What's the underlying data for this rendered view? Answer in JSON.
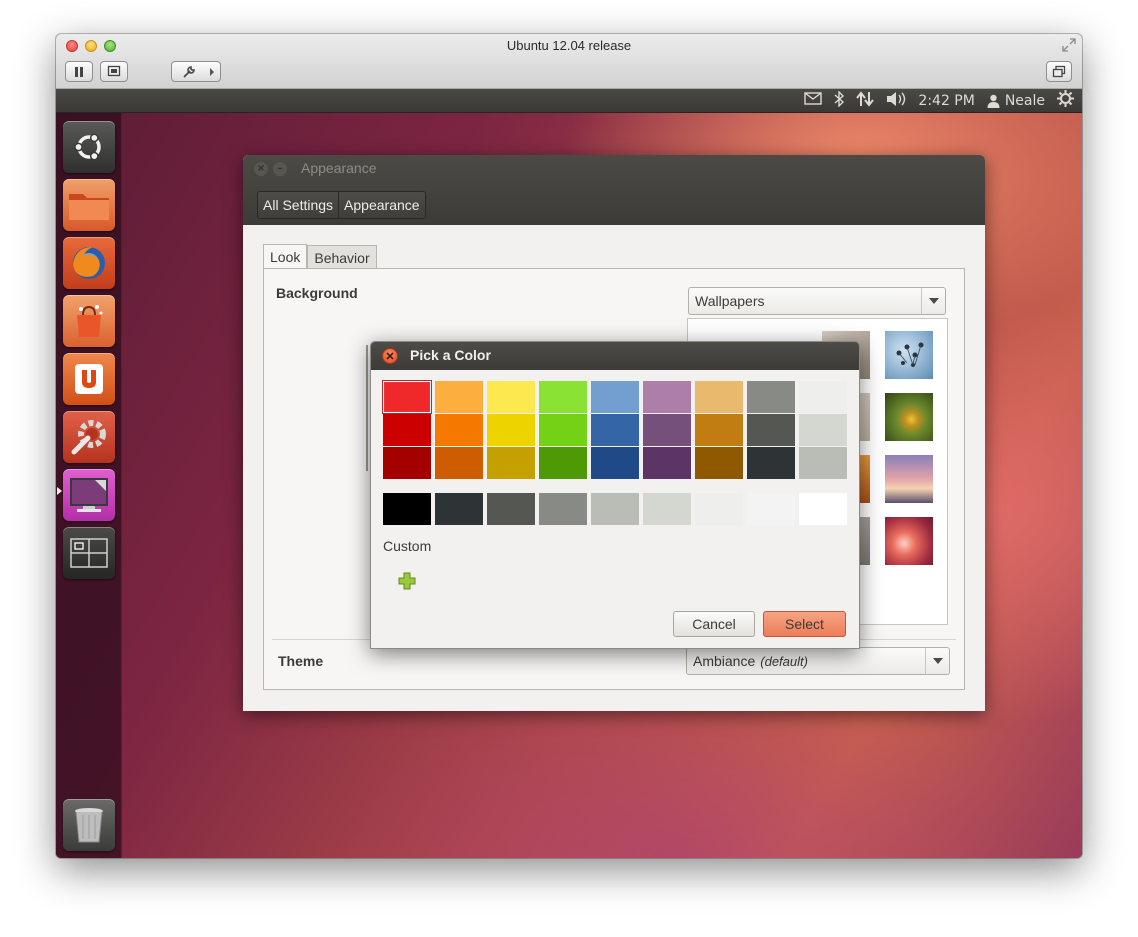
{
  "vm_window": {
    "title": "Ubuntu 12.04 release"
  },
  "top_panel": {
    "clock": "2:42 PM",
    "user": "Neale",
    "indicators": [
      "mail-icon",
      "bluetooth-icon",
      "network-icon",
      "volume-icon",
      "user-icon",
      "session-gear-icon"
    ]
  },
  "launcher": {
    "items": [
      {
        "name": "dash-home",
        "icon": "ubuntu-logo-icon"
      },
      {
        "name": "home-folder",
        "icon": "folder-icon"
      },
      {
        "name": "firefox",
        "icon": "firefox-icon"
      },
      {
        "name": "software-center",
        "icon": "shopping-bag-icon"
      },
      {
        "name": "ubuntu-one",
        "icon": "ubuntu-one-icon"
      },
      {
        "name": "system-settings",
        "icon": "settings-icon"
      },
      {
        "name": "appearance",
        "icon": "display-icon",
        "active": true
      },
      {
        "name": "workspace-switcher",
        "icon": "workspaces-icon"
      },
      {
        "name": "trash",
        "icon": "trash-icon"
      }
    ]
  },
  "appearance_window": {
    "title": "Appearance",
    "breadcrumbs": [
      "All Settings",
      "Appearance"
    ],
    "tabs": [
      "Look",
      "Behavior"
    ],
    "active_tab": "Look",
    "background_label": "Background",
    "wallpaper_source": "Wallpapers",
    "theme_label": "Theme",
    "theme_value": "Ambiance",
    "theme_default_note": "(default)"
  },
  "color_picker": {
    "title": "Pick a Color",
    "palette_rows": [
      [
        "#ef2929",
        "#fcaf3e",
        "#fce94f",
        "#8ae234",
        "#729fcf",
        "#ad7fa8",
        "#e9b96e",
        "#888a85",
        "#eeeeec"
      ],
      [
        "#cc0000",
        "#f57900",
        "#edd400",
        "#73d216",
        "#3465a4",
        "#75507b",
        "#c17d11",
        "#555753",
        "#d3d7cf"
      ],
      [
        "#a40000",
        "#ce5c00",
        "#c4a000",
        "#4e9a06",
        "#204a87",
        "#5c3566",
        "#8f5902",
        "#2e3436",
        "#babdb6"
      ]
    ],
    "gray_row": [
      "#000000",
      "#2e3436",
      "#555753",
      "#888a85",
      "#babdb6",
      "#d3d7cf",
      "#eeeeec",
      "#f3f3f3",
      "#ffffff"
    ],
    "selected_color": "#ef2929",
    "custom_label": "Custom",
    "cancel_label": "Cancel",
    "select_label": "Select"
  },
  "colors": {
    "ubuntu_orange": "#dd4814",
    "panel_dark": "#3c3b37"
  }
}
